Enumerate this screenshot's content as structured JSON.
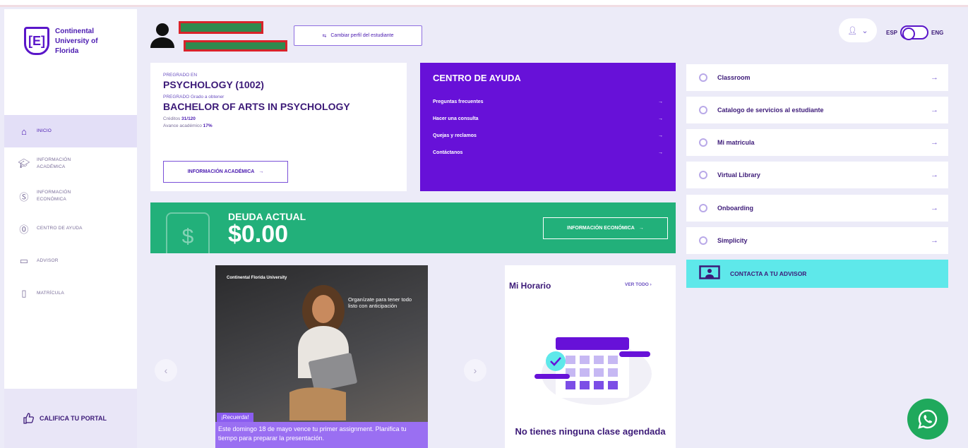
{
  "brand": {
    "name": "Continental University of Florida",
    "mark": "[E]"
  },
  "sidebar": {
    "items": [
      {
        "label": "INICIO",
        "icon": "home-icon"
      },
      {
        "label": "INFORMACIÓN ACADÉMICA",
        "icon": "graduation-cap-icon"
      },
      {
        "label": "INFORMACIÓN ECONÓMICA",
        "icon": "dollar-circle-icon"
      },
      {
        "label": "CENTRO DE AYUDA",
        "icon": "question-circle-icon"
      },
      {
        "label": "ADVISOR",
        "icon": "monitor-user-icon"
      },
      {
        "label": "MATRÍCULA",
        "icon": "document-icon"
      }
    ],
    "rate_label": "CALIFICA TU PORTAL"
  },
  "header": {
    "switch_profile_label": "Cambiar perfil del estudiante",
    "lang_left": "ESP",
    "lang_right": "ENG"
  },
  "program": {
    "pregrado_label": "PREGRADO EN",
    "pregrado_value": "PSYCHOLOGY (1002)",
    "grado_label": "PREGRADO Grado a obtener",
    "grado_value": "BACHELOR OF ARTS IN PSYCHOLOGY",
    "credits_label": "Créditos",
    "credits_value": "31/120",
    "progress_label": "Avance académico",
    "progress_value": "17%",
    "button_label": "INFORMACIÓN ACADÉMICA"
  },
  "help": {
    "title": "CENTRO DE AYUDA",
    "items": [
      "Preguntas frecuentes",
      "Hacer una consulta",
      "Quejas y reclamos",
      "Contáctanos"
    ]
  },
  "debt": {
    "label": "DEUDA ACTUAL",
    "amount": "$0.00",
    "button_label": "INFORMACIÓN ECONÓMICA",
    "icon_symbol": "$"
  },
  "promo": {
    "brand": "Continental Florida University",
    "note": "Organízate para tener todo listo con anticipación",
    "tag": "¡Recuerda!",
    "footer": "Este domingo 18 de mayo vence tu primer assignment. Planifica tu tiempo para preparar la presentación."
  },
  "schedule": {
    "title": "Mi Horario",
    "view_all": "VER TODO",
    "empty_msg": "No tienes ninguna clase agendada"
  },
  "links": [
    "Classroom",
    "Catalogo de servicios al estudiante",
    "Mi matricula",
    "Virtual Library",
    "Onboarding",
    "Simplicity"
  ],
  "advisor_label": "CONTACTA A TU ADVISOR",
  "colors": {
    "primary": "#6711d8",
    "green": "#22b07a",
    "cyan": "#5ee8ea",
    "whatsapp": "#1fa95c",
    "redaction": "#2f8a4e"
  }
}
